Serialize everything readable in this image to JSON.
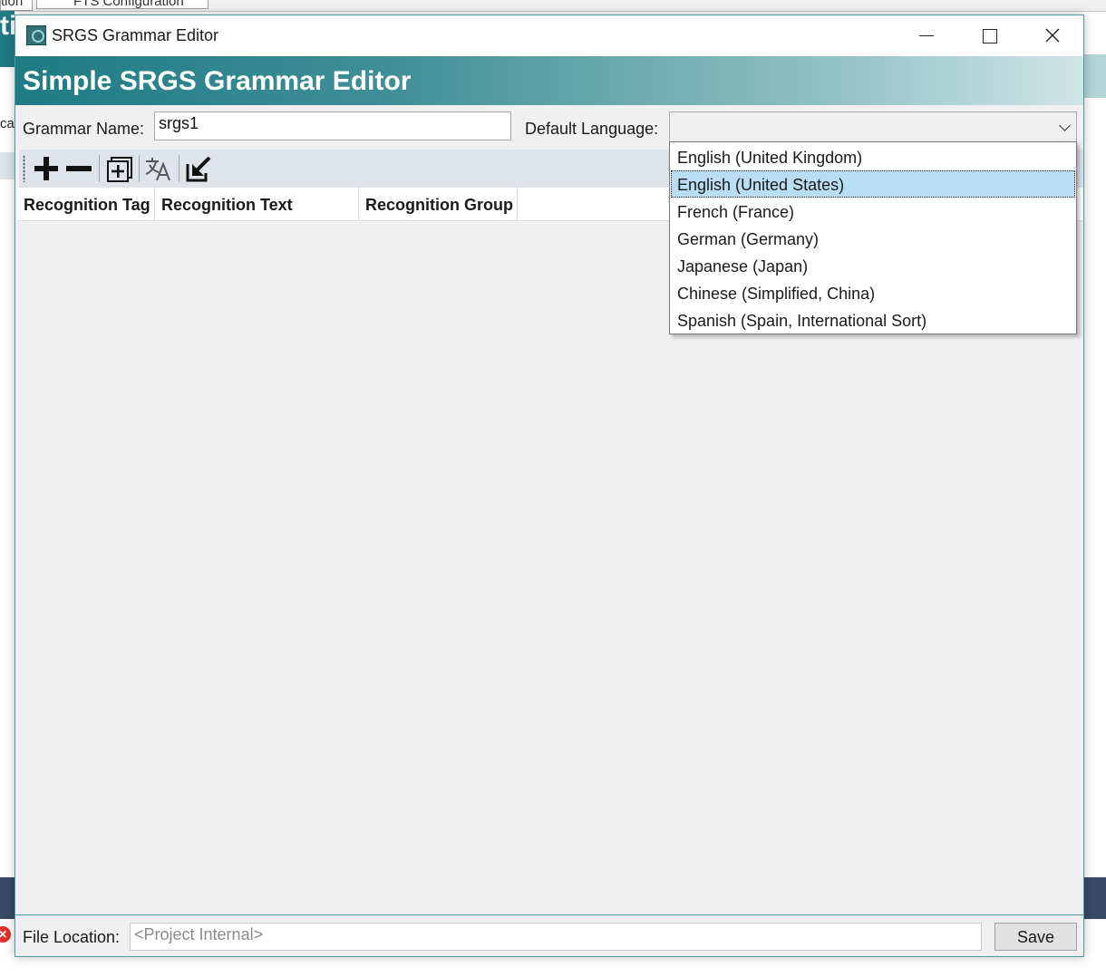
{
  "background": {
    "tab_1": "tion",
    "tab_2": "FTS Configuration",
    "banner_fragment": "ti",
    "left_label_fragment": "cal"
  },
  "window": {
    "title": "SRGS Grammar Editor",
    "header_title": "Simple SRGS Grammar Editor"
  },
  "form": {
    "grammar_name_label": "Grammar Name:",
    "grammar_name_value": "srgs1",
    "default_language_label": "Default Language:",
    "default_language_value": ""
  },
  "toolbar": {
    "buttons": [
      {
        "name": "add-icon"
      },
      {
        "name": "remove-icon"
      },
      {
        "name": "add-group-icon"
      },
      {
        "name": "translate-icon"
      },
      {
        "name": "import-icon"
      }
    ]
  },
  "grid": {
    "columns": [
      "Recognition Tag",
      "Recognition Text",
      "Recognition Group"
    ],
    "rows": []
  },
  "language_dropdown": {
    "options": [
      "English (United Kingdom)",
      "English (United States)",
      "French (France)",
      "German (Germany)",
      "Japanese (Japan)",
      "Chinese (Simplified, China)",
      "Spanish (Spain, International Sort)"
    ],
    "highlighted_index": 1
  },
  "footer": {
    "file_location_label": "File Location:",
    "file_location_placeholder": "<Project Internal>",
    "save_label": "Save"
  },
  "colors": {
    "accent": "#1f7b84",
    "highlight": "#b9def3",
    "error": "#e0322c"
  }
}
